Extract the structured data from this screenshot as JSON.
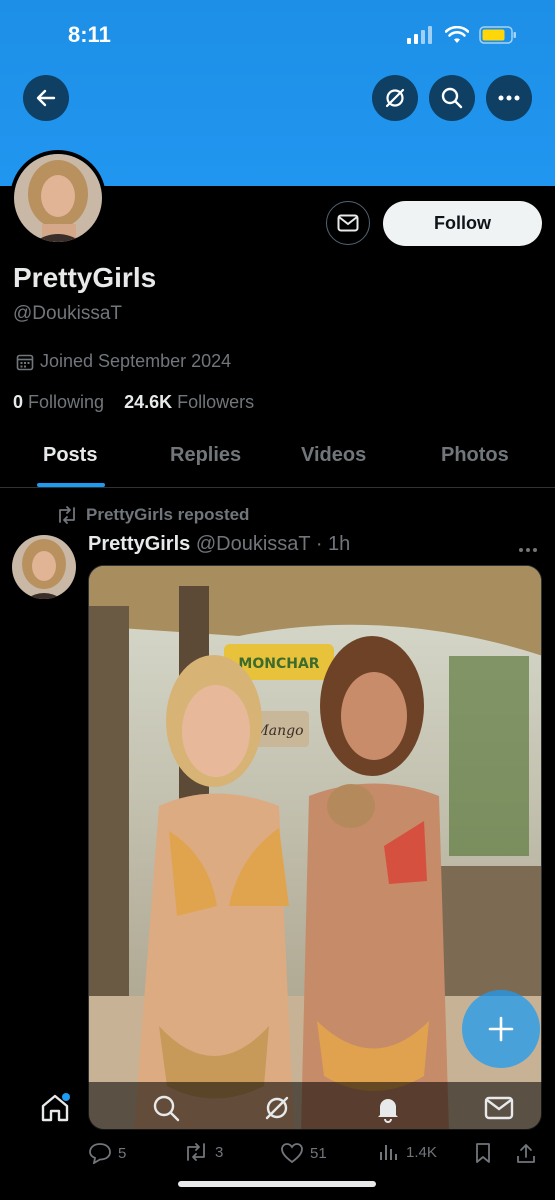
{
  "status": {
    "time": "8:11"
  },
  "header": {
    "back": "back",
    "grok": "grok",
    "search": "search",
    "more": "more"
  },
  "profile": {
    "name": "PrettyGirls",
    "handle": "@DoukissaT",
    "joined": "Joined September 2024",
    "following_count": "0",
    "following_label": "Following",
    "followers_count": "24.6K",
    "followers_label": "Followers",
    "follow_button": "Follow"
  },
  "tabs": [
    {
      "label": "Posts",
      "active": true
    },
    {
      "label": "Replies",
      "active": false
    },
    {
      "label": "Videos",
      "active": false
    },
    {
      "label": "Photos",
      "active": false
    }
  ],
  "post": {
    "repost_label": "PrettyGirls reposted",
    "author_name": "PrettyGirls",
    "author_handle": "@DoukissaT",
    "separator": "·",
    "time": "1h",
    "media": {
      "sign1": "MONCHAR",
      "sign2": "Mango"
    },
    "actions": {
      "replies": "5",
      "reposts": "3",
      "likes": "51",
      "views": "1.4K"
    }
  },
  "colors": {
    "accent": "#1d9bf0",
    "banner": "#1d8fe6",
    "background": "#000000",
    "muted": "#71767b"
  }
}
